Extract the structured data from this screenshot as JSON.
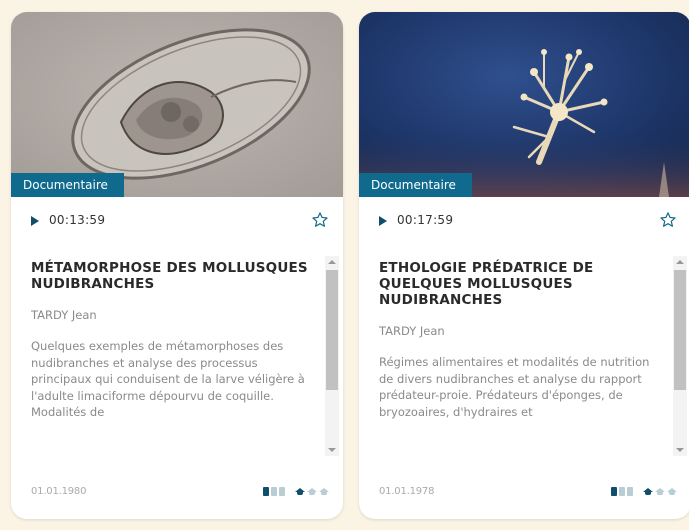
{
  "cards": [
    {
      "category": "Documentaire",
      "duration": "00:13:59",
      "title": "MÉTAMORPHOSE DES MOLLUSQUES NUDIBRANCHES",
      "author": "TARDY Jean",
      "description": "Quelques exemples de métamorphoses des nudibranches et analyse des processus principaux qui conduisent de la larve véligère à l'adulte limaciforme dépourvu de coquille. Modalités de",
      "date": "01.01.1980",
      "thumbnail_icon": "microscope-larva-image",
      "level_document": 1,
      "level_education": 1
    },
    {
      "category": "Documentaire",
      "duration": "00:17:59",
      "title": "ETHOLOGIE PRÉDATRICE DE QUELQUES MOLLUSQUES NUDIBRANCHES",
      "author": "TARDY Jean",
      "description": "Régimes alimentaires et modalités de nutrition de divers nudibranches et analyse du rapport prédateur-proie. Prédateurs d'éponges, de bryozoaires, d'hydraires et",
      "date": "01.01.1978",
      "thumbnail_icon": "underwater-hydroid-image",
      "level_document": 1,
      "level_education": 1
    }
  ],
  "colors": {
    "background": "#fbf4e4",
    "accent": "#0f6a8e",
    "accent_dark": "#0f4f6b"
  }
}
